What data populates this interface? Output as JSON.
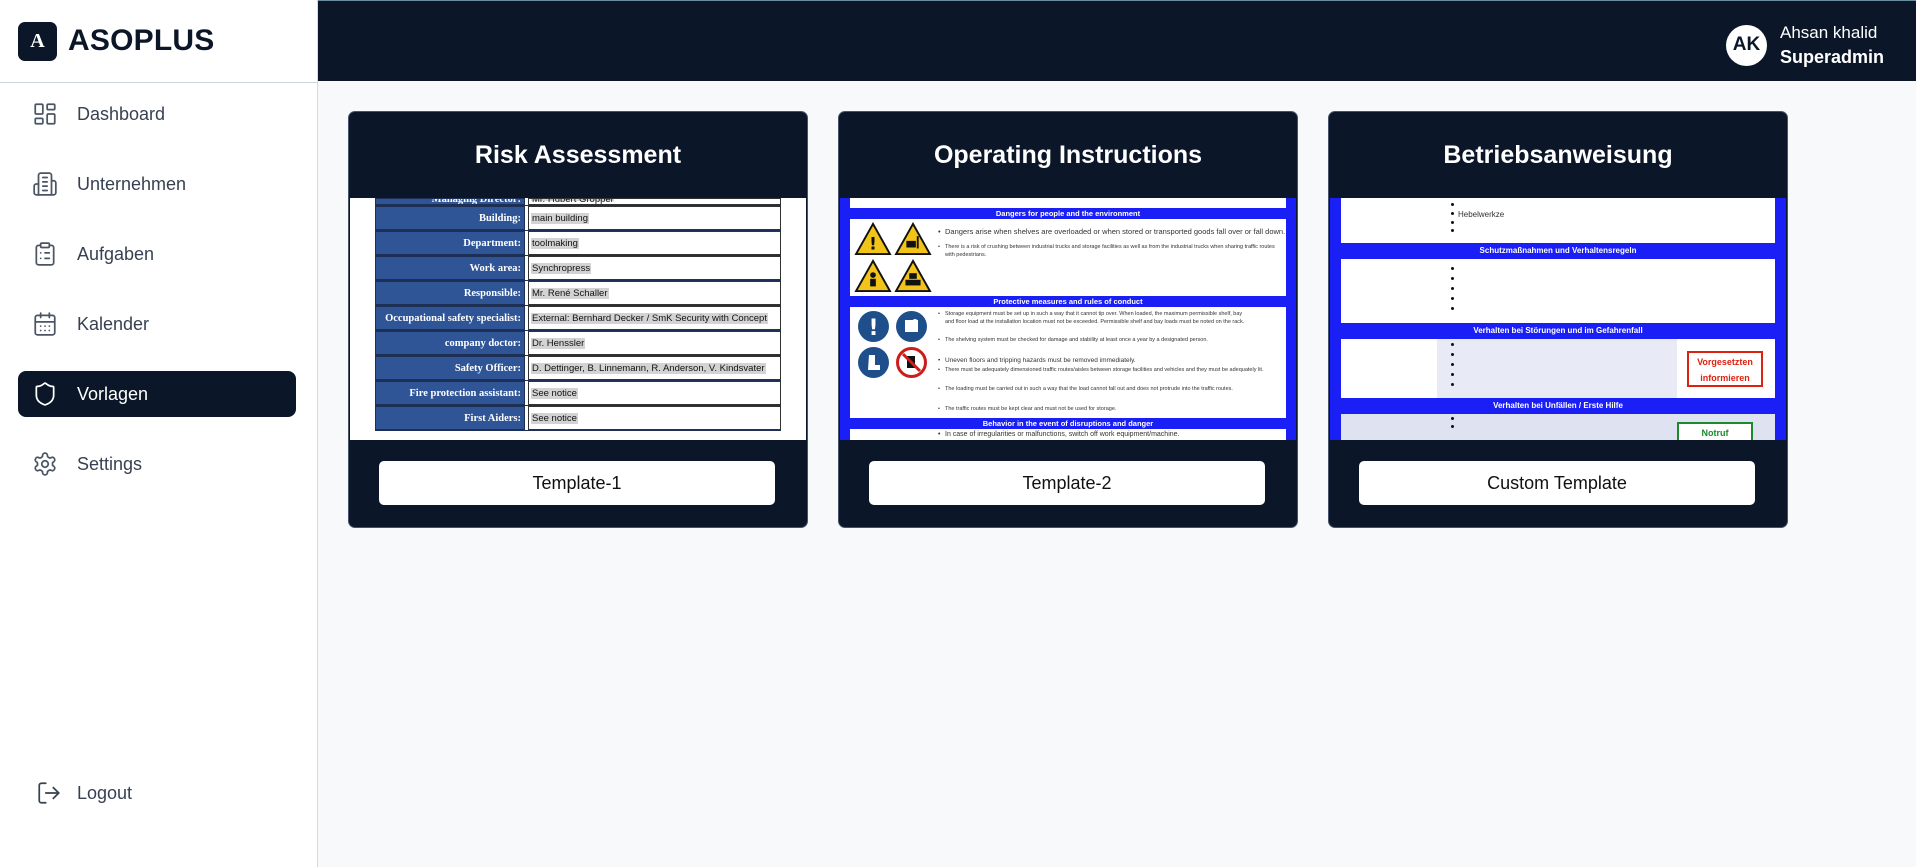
{
  "brand": {
    "logo_letter": "A",
    "name": "ASOPLUS"
  },
  "sidebar": {
    "items": [
      {
        "label": "Dashboard",
        "icon": "dashboard-icon",
        "active": false
      },
      {
        "label": "Unternehmen",
        "icon": "building-icon",
        "active": false
      },
      {
        "label": "Aufgaben",
        "icon": "clipboard-icon",
        "active": false
      },
      {
        "label": "Kalender",
        "icon": "calendar-icon",
        "active": false
      },
      {
        "label": "Vorlagen",
        "icon": "shield-icon",
        "active": true
      },
      {
        "label": "Settings",
        "icon": "gear-icon",
        "active": false
      }
    ],
    "logout_label": "Logout"
  },
  "header": {
    "user": {
      "initials": "AK",
      "name": "Ahsan khalid",
      "role": "Superadmin"
    }
  },
  "colors": {
    "primary": "#0b1628",
    "preview_blue": "#1a1ff5",
    "form_label_blue": "#2f5597"
  },
  "templates": [
    {
      "title": "Risk Assessment",
      "button_label": "Template-1",
      "preview": {
        "rows": [
          {
            "label": "Managing Director:",
            "value": "Mr. Hubert Groppel"
          },
          {
            "label": "Building:",
            "value": "main building"
          },
          {
            "label": "Department:",
            "value": "toolmaking"
          },
          {
            "label": "Work area:",
            "value": "Synchropress"
          },
          {
            "label": "Responsible:",
            "value": "Mr. René Schaller"
          },
          {
            "label": "Occupational safety specialist:",
            "value": "External: Bernhard Decker / SmK Security with Concept"
          },
          {
            "label": "company doctor:",
            "value": "Dr. Henssler"
          },
          {
            "label": "Safety Officer:",
            "value": "D. Dettinger, B. Linnemann, R. Anderson, V. Kindsvater"
          },
          {
            "label": "Fire protection assistant:",
            "value": "See notice"
          },
          {
            "label": "First Aiders:",
            "value": "See notice"
          }
        ]
      }
    },
    {
      "title": "Operating Instructions",
      "button_label": "Template-2",
      "preview": {
        "sections": [
          "Dangers for people and the environment",
          "Protective measures and rules of conduct",
          "Behavior in the event of disruptions and danger"
        ],
        "lines_section1": [
          "Dangers arise when shelves are overloaded or when stored or transported goods fall over or fall down.",
          "There is a risk of crushing between industrial trucks and storage facilities as well as from the industrial trucks when sharing traffic routes with pedestrians."
        ],
        "lines_section2": [
          "Storage equipment must be set up in such a way that it cannot tip over. When loaded, the maximum permissible shelf, bay and floor load at the installation location must not be exceeded. Permissible shelf and bay loads must be noted on the rack.",
          "The shelving system must be checked for damage and stability at least once a year by a designated person.",
          "Uneven floors and tripping hazards must be removed immediately.",
          "There must be adequately dimensioned traffic routes/aisles between storage facilities and vehicles and they must be adequately lit.",
          "The loading must be carried out in such a way that the load cannot fall out and does not protrude into the traffic routes.",
          "The traffic routes must be kept clear and must not be used for storage."
        ],
        "lines_section3": [
          "In case of irregularities or malfunctions, switch off work equipment/machine."
        ]
      }
    },
    {
      "title": "Betriebsanweisung",
      "button_label": "Custom Template",
      "preview": {
        "top_text": "Hebelwerkze",
        "sections": [
          "Schutzmaßnahmen und Verhaltensregeln",
          "Verhalten bei Störungen und im Gefahrenfall",
          "Verhalten bei Unfällen / Erste Hilfe"
        ],
        "red_badge": "Vorgesetzten informieren",
        "green_badge": "Notruf"
      }
    }
  ]
}
